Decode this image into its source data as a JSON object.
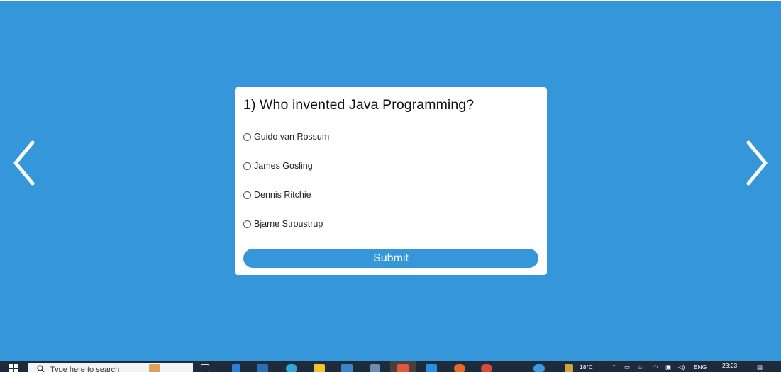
{
  "quiz": {
    "question": "1) Who invented Java Programming?",
    "options": [
      "Guido van Rossum",
      "James Gosling",
      "Dennis Ritchie",
      "Bjarne Stroustrup"
    ],
    "submit_label": "Submit"
  },
  "navigation": {
    "prev_icon": "chevron-left-icon",
    "next_icon": "chevron-right-icon"
  },
  "colors": {
    "background": "#3597d9",
    "card": "#ffffff",
    "button": "#3597d9",
    "taskbar": "#1e2b3a"
  },
  "taskbar": {
    "search_placeholder": "Type here to search",
    "weather": "18°C",
    "language": "ENG",
    "time": "23:23"
  }
}
